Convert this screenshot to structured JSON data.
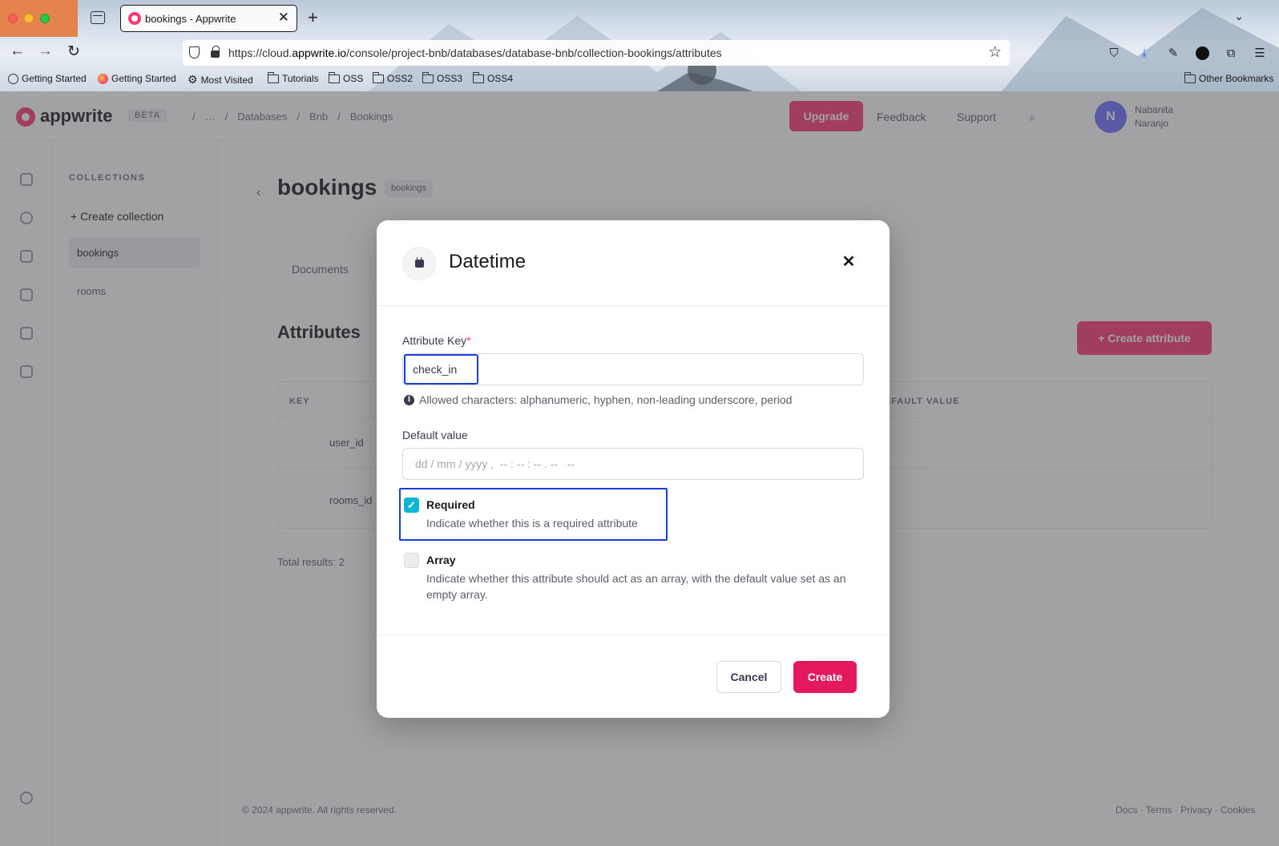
{
  "browser": {
    "tab_title": "bookings - Appwrite",
    "url_prefix": "https://cloud.",
    "url_domain": "appwrite.io",
    "url_path": "/console/project-bnb/databases/database-bnb/collection-bookings/attributes",
    "bookmarks": [
      "Getting Started",
      "Getting Started",
      "Most Visited",
      "Tutorials",
      "OSS",
      "OSS2",
      "OSS3",
      "OSS4"
    ],
    "other_bookmarks": "Other Bookmarks"
  },
  "modal": {
    "title": "Datetime",
    "icon": "calendar-icon",
    "attribute_key_label": "Attribute Key",
    "required_marker": "*",
    "attribute_key_value": "check_in",
    "key_hint": "Allowed characters: alphanumeric, hyphen, non-leading underscore, period",
    "default_value_label": "Default value",
    "default_value_placeholder": "dd / mm / yyyy ,  -- : -- : -- . --   --",
    "required": {
      "checked": true,
      "title": "Required",
      "description": "Indicate whether this is a required attribute"
    },
    "array": {
      "checked": false,
      "title": "Array",
      "description": "Indicate whether this attribute should act as an array, with the default value set as an empty array."
    },
    "cancel_label": "Cancel",
    "create_label": "Create"
  },
  "colors": {
    "accent": "#e3195c",
    "checkbox": "#06b6d4",
    "focus_outline": "#1b3ed8"
  }
}
